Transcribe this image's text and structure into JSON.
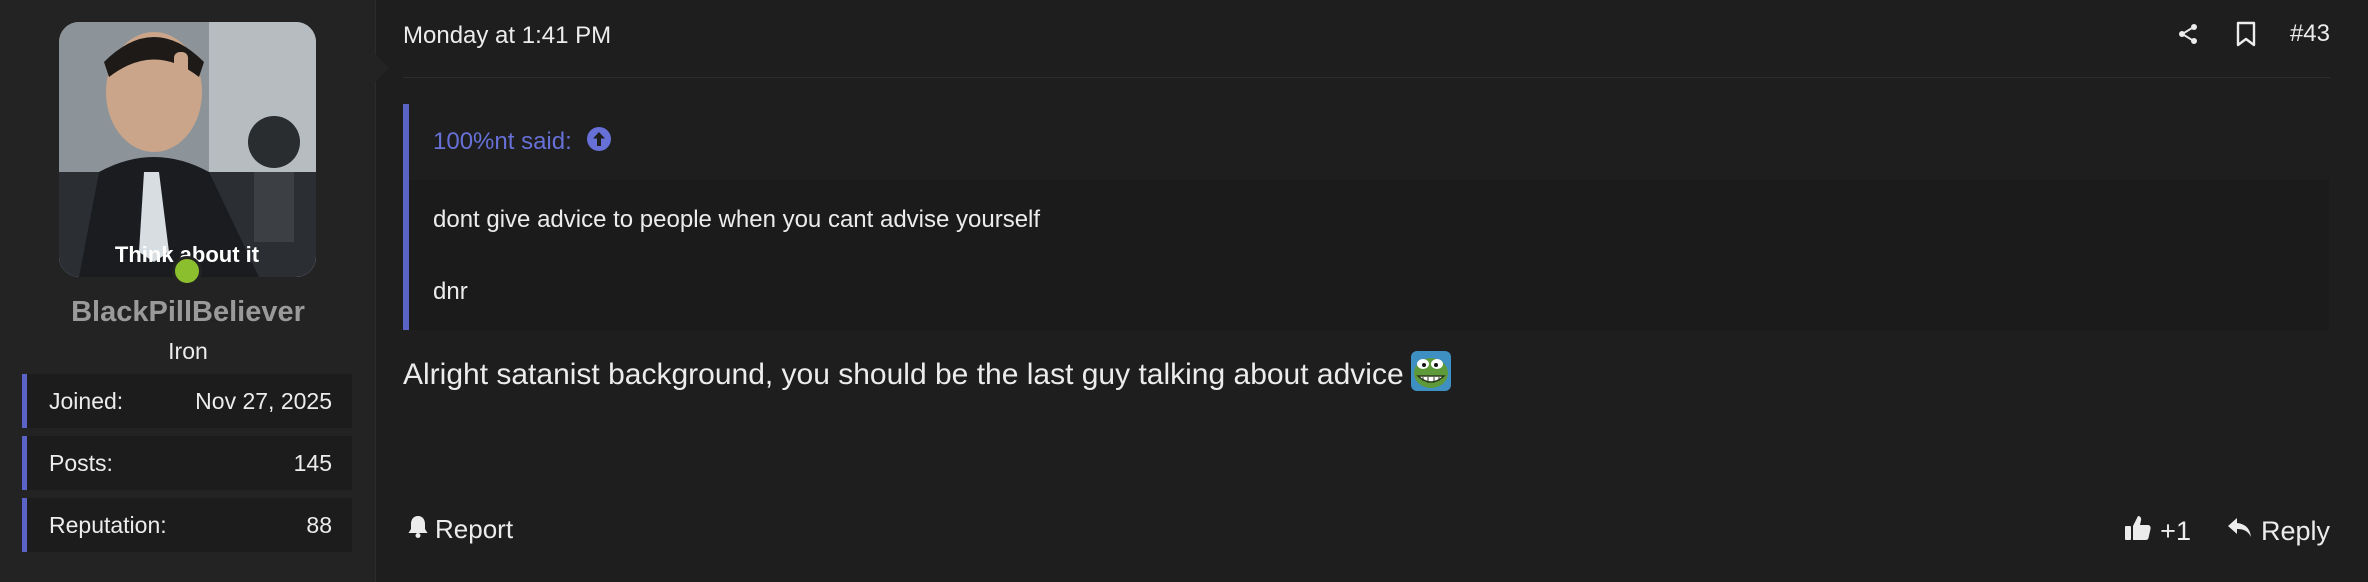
{
  "user": {
    "avatar_caption": "Think about it",
    "username": "BlackPillBeliever",
    "rank": "Iron",
    "online": true,
    "stats": [
      {
        "label": "Joined:",
        "value": "Nov 27, 2025"
      },
      {
        "label": "Posts:",
        "value": "145"
      },
      {
        "label": "Reputation:",
        "value": "88"
      }
    ]
  },
  "post": {
    "date": "Monday at 1:41 PM",
    "number": "#43",
    "header_icons": [
      "share-icon",
      "bookmark-icon"
    ],
    "quote": {
      "author_said": "100%nt said:",
      "icon": "arrow-up-circle-icon",
      "lines": [
        "dont give advice to people when you cant advise yourself",
        "dnr"
      ]
    },
    "message": "Alright satanist background, you should be the last guy talking about advice",
    "emoji": "pepe-grin-emoji"
  },
  "footer": {
    "report_label": "Report",
    "react_label": "+1",
    "reply_label": "Reply"
  },
  "colors": {
    "accent": "#5c63c7",
    "quote_author": "#6670d6",
    "online": "#8cbf2e",
    "username": "#9a9a9a"
  }
}
